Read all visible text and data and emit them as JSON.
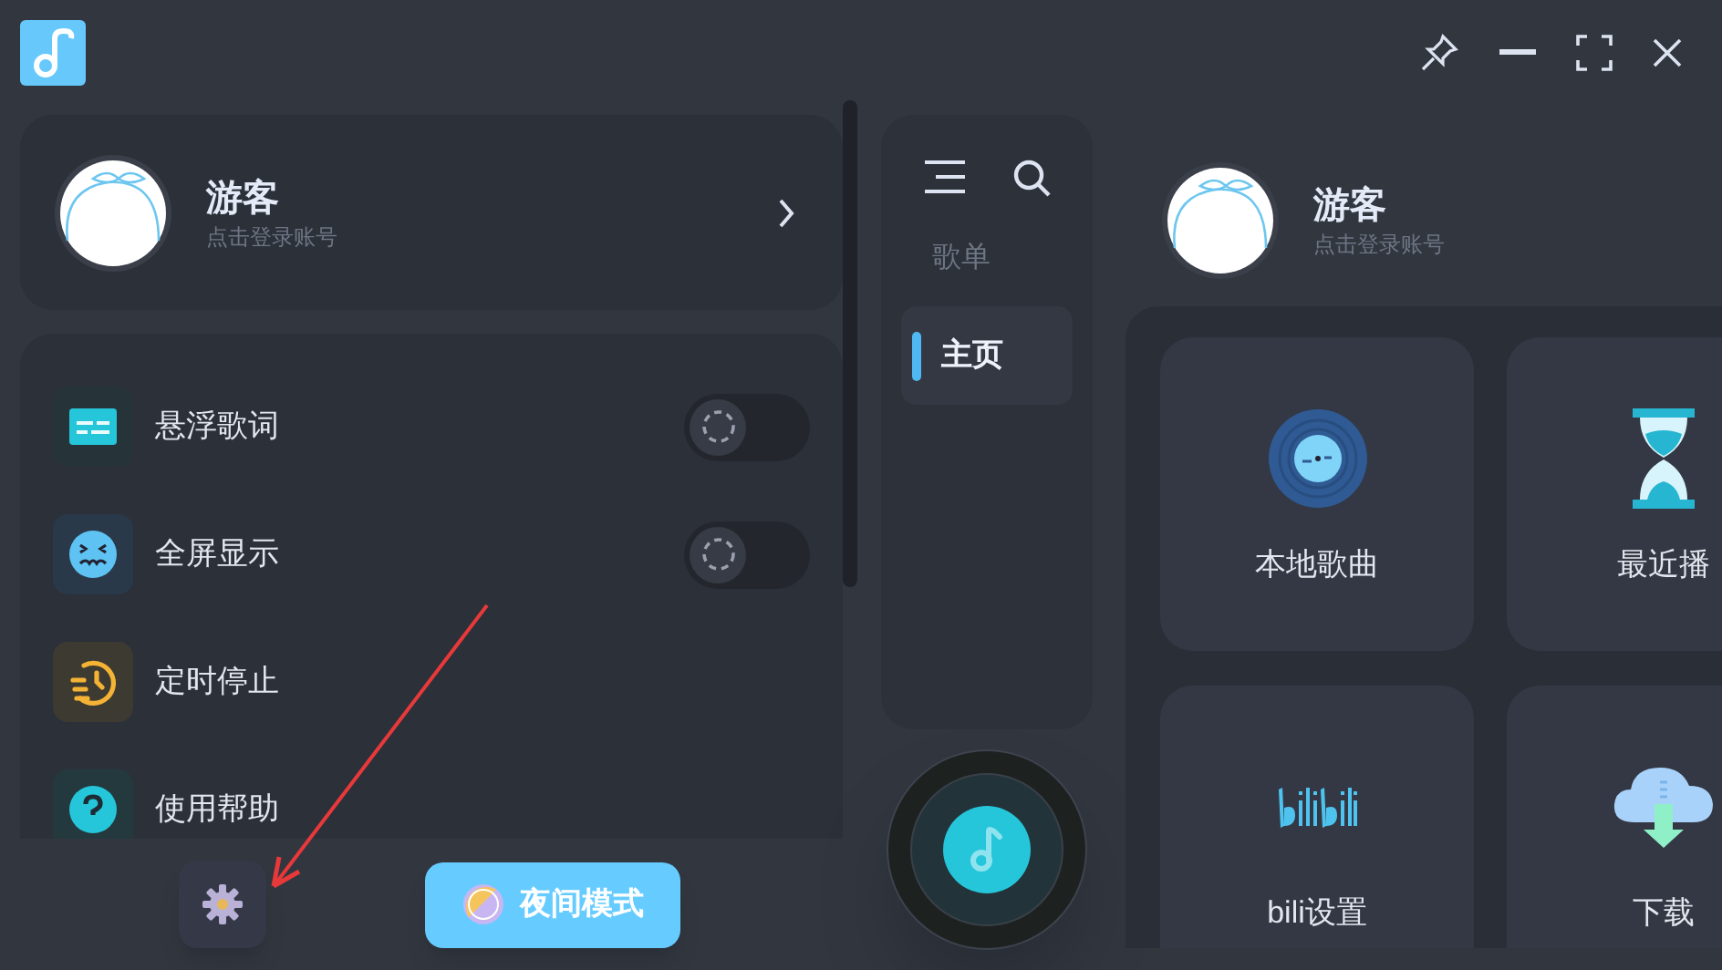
{
  "sidebar_profile": {
    "name": "游客",
    "subtitle": "点击登录账号"
  },
  "settings": [
    {
      "kind": "toggle",
      "label": "悬浮歌词",
      "on": false
    },
    {
      "kind": "toggle",
      "label": "全屏显示",
      "on": false
    },
    {
      "kind": "link",
      "label": "定时停止"
    },
    {
      "kind": "link",
      "label": "使用帮助"
    }
  ],
  "bottom_bar": {
    "night_mode_button": "夜间模式"
  },
  "nav": {
    "items": [
      {
        "label": "歌单",
        "selected": false
      },
      {
        "label": "主页",
        "selected": true
      }
    ]
  },
  "home": {
    "profile": {
      "name": "游客",
      "subtitle": "点击登录账号"
    },
    "tiles": [
      {
        "label": "本地歌曲"
      },
      {
        "label": "最近播"
      },
      {
        "label": "bili设置"
      },
      {
        "label": "下载"
      }
    ]
  }
}
